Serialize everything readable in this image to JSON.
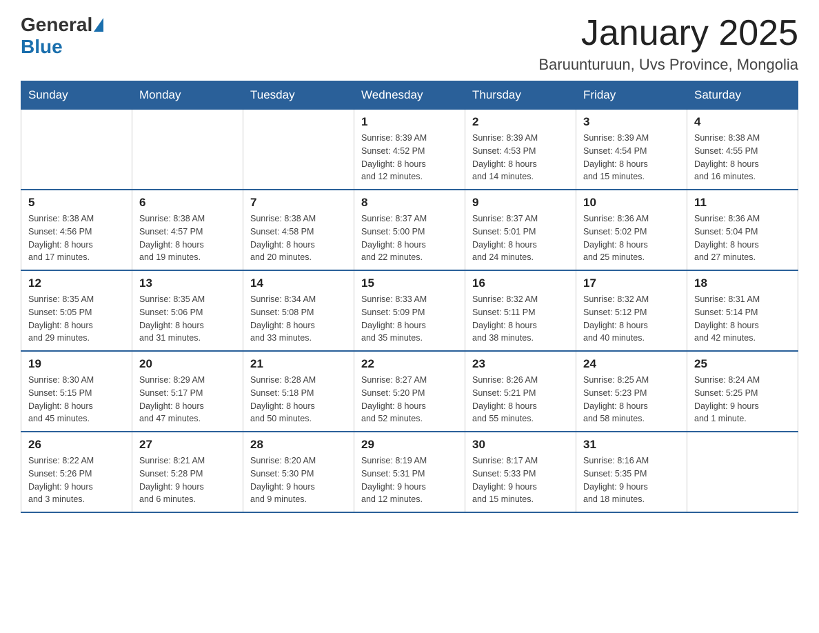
{
  "header": {
    "logo_general": "General",
    "logo_blue": "Blue",
    "month_title": "January 2025",
    "location": "Baruunturuun, Uvs Province, Mongolia"
  },
  "weekdays": [
    "Sunday",
    "Monday",
    "Tuesday",
    "Wednesday",
    "Thursday",
    "Friday",
    "Saturday"
  ],
  "weeks": [
    [
      {
        "day": "",
        "info": ""
      },
      {
        "day": "",
        "info": ""
      },
      {
        "day": "",
        "info": ""
      },
      {
        "day": "1",
        "info": "Sunrise: 8:39 AM\nSunset: 4:52 PM\nDaylight: 8 hours\nand 12 minutes."
      },
      {
        "day": "2",
        "info": "Sunrise: 8:39 AM\nSunset: 4:53 PM\nDaylight: 8 hours\nand 14 minutes."
      },
      {
        "day": "3",
        "info": "Sunrise: 8:39 AM\nSunset: 4:54 PM\nDaylight: 8 hours\nand 15 minutes."
      },
      {
        "day": "4",
        "info": "Sunrise: 8:38 AM\nSunset: 4:55 PM\nDaylight: 8 hours\nand 16 minutes."
      }
    ],
    [
      {
        "day": "5",
        "info": "Sunrise: 8:38 AM\nSunset: 4:56 PM\nDaylight: 8 hours\nand 17 minutes."
      },
      {
        "day": "6",
        "info": "Sunrise: 8:38 AM\nSunset: 4:57 PM\nDaylight: 8 hours\nand 19 minutes."
      },
      {
        "day": "7",
        "info": "Sunrise: 8:38 AM\nSunset: 4:58 PM\nDaylight: 8 hours\nand 20 minutes."
      },
      {
        "day": "8",
        "info": "Sunrise: 8:37 AM\nSunset: 5:00 PM\nDaylight: 8 hours\nand 22 minutes."
      },
      {
        "day": "9",
        "info": "Sunrise: 8:37 AM\nSunset: 5:01 PM\nDaylight: 8 hours\nand 24 minutes."
      },
      {
        "day": "10",
        "info": "Sunrise: 8:36 AM\nSunset: 5:02 PM\nDaylight: 8 hours\nand 25 minutes."
      },
      {
        "day": "11",
        "info": "Sunrise: 8:36 AM\nSunset: 5:04 PM\nDaylight: 8 hours\nand 27 minutes."
      }
    ],
    [
      {
        "day": "12",
        "info": "Sunrise: 8:35 AM\nSunset: 5:05 PM\nDaylight: 8 hours\nand 29 minutes."
      },
      {
        "day": "13",
        "info": "Sunrise: 8:35 AM\nSunset: 5:06 PM\nDaylight: 8 hours\nand 31 minutes."
      },
      {
        "day": "14",
        "info": "Sunrise: 8:34 AM\nSunset: 5:08 PM\nDaylight: 8 hours\nand 33 minutes."
      },
      {
        "day": "15",
        "info": "Sunrise: 8:33 AM\nSunset: 5:09 PM\nDaylight: 8 hours\nand 35 minutes."
      },
      {
        "day": "16",
        "info": "Sunrise: 8:32 AM\nSunset: 5:11 PM\nDaylight: 8 hours\nand 38 minutes."
      },
      {
        "day": "17",
        "info": "Sunrise: 8:32 AM\nSunset: 5:12 PM\nDaylight: 8 hours\nand 40 minutes."
      },
      {
        "day": "18",
        "info": "Sunrise: 8:31 AM\nSunset: 5:14 PM\nDaylight: 8 hours\nand 42 minutes."
      }
    ],
    [
      {
        "day": "19",
        "info": "Sunrise: 8:30 AM\nSunset: 5:15 PM\nDaylight: 8 hours\nand 45 minutes."
      },
      {
        "day": "20",
        "info": "Sunrise: 8:29 AM\nSunset: 5:17 PM\nDaylight: 8 hours\nand 47 minutes."
      },
      {
        "day": "21",
        "info": "Sunrise: 8:28 AM\nSunset: 5:18 PM\nDaylight: 8 hours\nand 50 minutes."
      },
      {
        "day": "22",
        "info": "Sunrise: 8:27 AM\nSunset: 5:20 PM\nDaylight: 8 hours\nand 52 minutes."
      },
      {
        "day": "23",
        "info": "Sunrise: 8:26 AM\nSunset: 5:21 PM\nDaylight: 8 hours\nand 55 minutes."
      },
      {
        "day": "24",
        "info": "Sunrise: 8:25 AM\nSunset: 5:23 PM\nDaylight: 8 hours\nand 58 minutes."
      },
      {
        "day": "25",
        "info": "Sunrise: 8:24 AM\nSunset: 5:25 PM\nDaylight: 9 hours\nand 1 minute."
      }
    ],
    [
      {
        "day": "26",
        "info": "Sunrise: 8:22 AM\nSunset: 5:26 PM\nDaylight: 9 hours\nand 3 minutes."
      },
      {
        "day": "27",
        "info": "Sunrise: 8:21 AM\nSunset: 5:28 PM\nDaylight: 9 hours\nand 6 minutes."
      },
      {
        "day": "28",
        "info": "Sunrise: 8:20 AM\nSunset: 5:30 PM\nDaylight: 9 hours\nand 9 minutes."
      },
      {
        "day": "29",
        "info": "Sunrise: 8:19 AM\nSunset: 5:31 PM\nDaylight: 9 hours\nand 12 minutes."
      },
      {
        "day": "30",
        "info": "Sunrise: 8:17 AM\nSunset: 5:33 PM\nDaylight: 9 hours\nand 15 minutes."
      },
      {
        "day": "31",
        "info": "Sunrise: 8:16 AM\nSunset: 5:35 PM\nDaylight: 9 hours\nand 18 minutes."
      },
      {
        "day": "",
        "info": ""
      }
    ]
  ]
}
